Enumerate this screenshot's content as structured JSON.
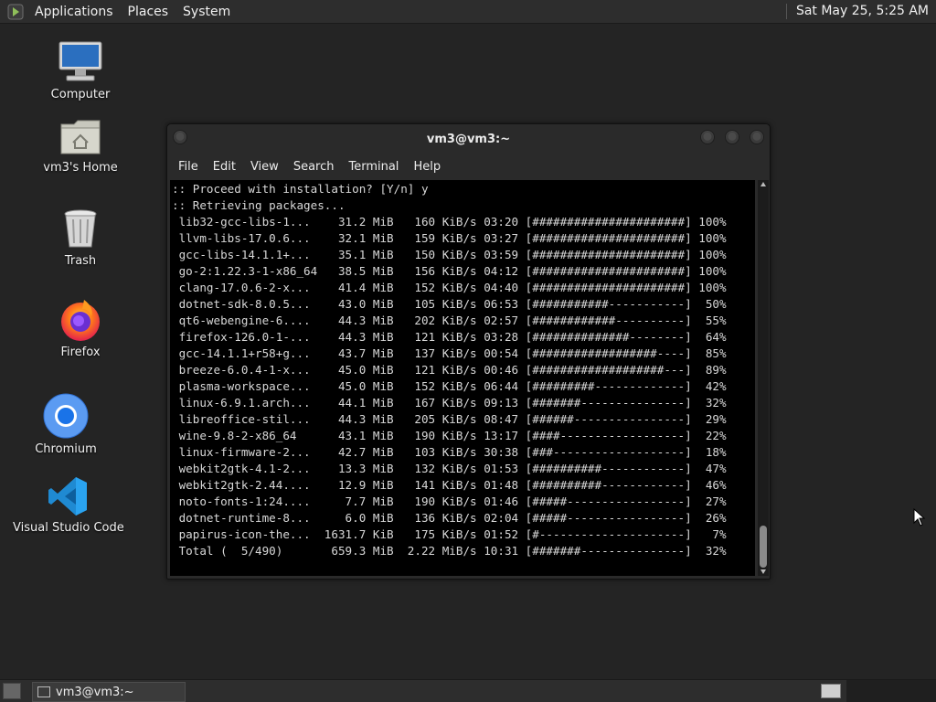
{
  "top_panel": {
    "menus": [
      "Applications",
      "Places",
      "System"
    ],
    "clock": "Sat May 25,  5:25 AM"
  },
  "desktop_icons": [
    {
      "label": "Computer",
      "icon": "computer-icon"
    },
    {
      "label": "vm3's Home",
      "icon": "home-folder-icon"
    },
    {
      "label": "Trash",
      "icon": "trash-icon"
    },
    {
      "label": "Firefox",
      "icon": "firefox-icon"
    },
    {
      "label": "Chromium",
      "icon": "chromium-icon"
    },
    {
      "label": "Visual Studio Code",
      "icon": "vscode-icon"
    }
  ],
  "terminal": {
    "title": "vm3@vm3:~",
    "menu": [
      "File",
      "Edit",
      "View",
      "Search",
      "Terminal",
      "Help"
    ],
    "lines": [
      ":: Proceed with installation? [Y/n] y",
      ":: Retrieving packages...",
      " lib32-gcc-libs-1...    31.2 MiB   160 KiB/s 03:20 [######################] 100%",
      " llvm-libs-17.0.6...    32.1 MiB   159 KiB/s 03:27 [######################] 100%",
      " gcc-libs-14.1.1+...    35.1 MiB   150 KiB/s 03:59 [######################] 100%",
      " go-2:1.22.3-1-x86_64   38.5 MiB   156 KiB/s 04:12 [######################] 100%",
      " clang-17.0.6-2-x...    41.4 MiB   152 KiB/s 04:40 [######################] 100%",
      " dotnet-sdk-8.0.5...    43.0 MiB   105 KiB/s 06:53 [###########-----------]  50%",
      " qt6-webengine-6....    44.3 MiB   202 KiB/s 02:57 [############----------]  55%",
      " firefox-126.0-1-...    44.3 MiB   121 KiB/s 03:28 [##############--------]  64%",
      " gcc-14.1.1+r58+g...    43.7 MiB   137 KiB/s 00:54 [##################----]  85%",
      " breeze-6.0.4-1-x...    45.0 MiB   121 KiB/s 00:46 [###################---]  89%",
      " plasma-workspace...    45.0 MiB   152 KiB/s 06:44 [#########-------------]  42%",
      " linux-6.9.1.arch...    44.1 MiB   167 KiB/s 09:13 [#######---------------]  32%",
      " libreoffice-stil...    44.3 MiB   205 KiB/s 08:47 [######----------------]  29%",
      " wine-9.8-2-x86_64      43.1 MiB   190 KiB/s 13:17 [####------------------]  22%",
      " linux-firmware-2...    42.7 MiB   103 KiB/s 30:38 [###-------------------]  18%",
      " webkit2gtk-4.1-2...    13.3 MiB   132 KiB/s 01:53 [##########------------]  47%",
      " webkit2gtk-2.44....    12.9 MiB   141 KiB/s 01:48 [##########------------]  46%",
      " noto-fonts-1:24....     7.7 MiB   190 KiB/s 01:46 [#####-----------------]  27%",
      " dotnet-runtime-8...     6.0 MiB   136 KiB/s 02:04 [#####-----------------]  26%",
      " papirus-icon-the...  1631.7 KiB   175 KiB/s 01:52 [#---------------------]   7%",
      " Total (  5/490)       659.3 MiB  2.22 MiB/s 10:31 [#######---------------]  32%"
    ]
  },
  "bottom_panel": {
    "task_label": "vm3@vm3:~"
  }
}
